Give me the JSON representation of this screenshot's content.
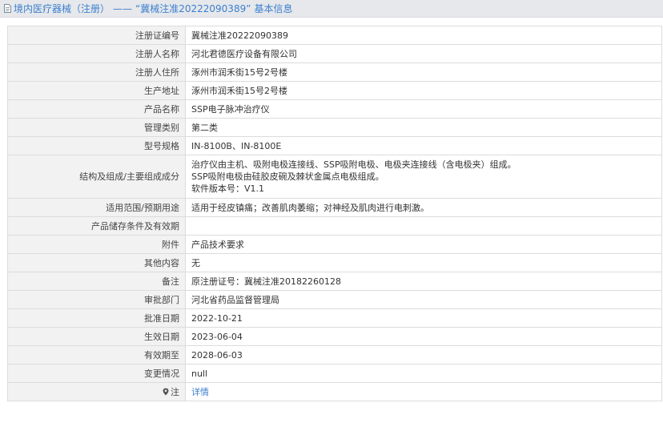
{
  "header": {
    "category": "境内医疗器械（注册）",
    "separator": "——",
    "subject": "“冀械注准20222090389”",
    "suffix": "基本信息"
  },
  "rows": [
    {
      "label": "注册证编号",
      "value": "冀械注准20222090389"
    },
    {
      "label": "注册人名称",
      "value": "河北君德医疗设备有限公司"
    },
    {
      "label": "注册人住所",
      "value": "涿州市润禾街15号2号楼"
    },
    {
      "label": "生产地址",
      "value": "涿州市润禾街15号2号楼"
    },
    {
      "label": "产品名称",
      "value": "SSP电子脉冲治疗仪"
    },
    {
      "label": "管理类别",
      "value": "第二类"
    },
    {
      "label": "型号规格",
      "value": "IN-8100B、IN-8100E"
    },
    {
      "label": "结构及组成/主要组成成分",
      "lines": [
        "治疗仪由主机、吸附电极连接线、SSP吸附电极、电极夹连接线（含电极夹）组成。",
        "SSP吸附电极由硅胶皮碗及棘状金属点电极组成。",
        "软件版本号：V1.1"
      ]
    },
    {
      "label": "适用范围/预期用途",
      "value": "适用于经皮镇痛；改善肌肉萎缩；对神经及肌肉进行电刺激。"
    },
    {
      "label": "产品储存条件及有效期",
      "value": ""
    },
    {
      "label": "附件",
      "value": "产品技术要求"
    },
    {
      "label": "其他内容",
      "value": "无"
    },
    {
      "label": "备注",
      "value": "原注册证号：冀械注准20182260128"
    },
    {
      "label": "审批部门",
      "value": "河北省药品监督管理局"
    },
    {
      "label": "批准日期",
      "value": "2022-10-21"
    },
    {
      "label": "生效日期",
      "value": "2023-06-04"
    },
    {
      "label": "有效期至",
      "value": "2028-06-03"
    },
    {
      "label": "变更情况",
      "value": "null"
    },
    {
      "label": "注",
      "value": "详情",
      "icon": "pin-icon",
      "link": true
    }
  ],
  "colors": {
    "accent": "#3d7fcf",
    "label_bg": "#f2f2f2",
    "border": "#dcdcdc"
  }
}
